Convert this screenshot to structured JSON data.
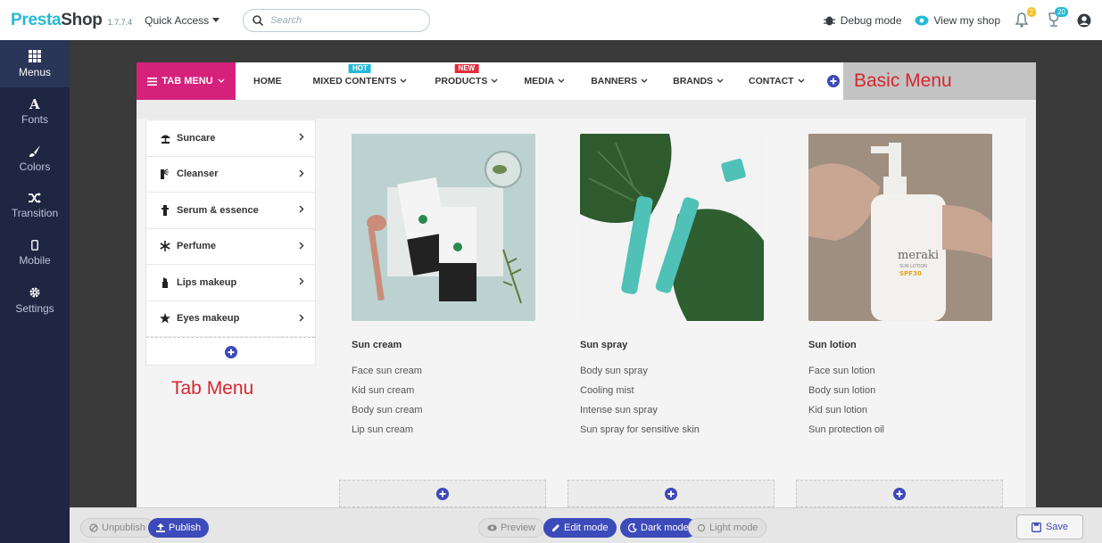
{
  "topbar": {
    "logo_part1": "Presta",
    "logo_part2": "Shop",
    "version": "1.7.7.4",
    "quick_access": "Quick Access",
    "search_placeholder": "Search",
    "debug_mode": "Debug mode",
    "view_shop": "View my shop",
    "notif_badge": "2",
    "notif2_badge": "20"
  },
  "sidebar": {
    "items": [
      {
        "label": "Menus",
        "icon": "grid-icon"
      },
      {
        "label": "Fonts",
        "icon": "font-icon"
      },
      {
        "label": "Colors",
        "icon": "brush-icon"
      },
      {
        "label": "Transition",
        "icon": "shuffle-icon"
      },
      {
        "label": "Mobile",
        "icon": "mobile-icon"
      },
      {
        "label": "Settings",
        "icon": "gear-icon"
      }
    ]
  },
  "menubar": {
    "tab_menu": "TAB MENU",
    "items": [
      {
        "label": "HOME",
        "tag": "",
        "dropdown": false
      },
      {
        "label": "MIXED CONTENTS",
        "tag": "HOT",
        "tag_color": "#25b9d7",
        "dropdown": true
      },
      {
        "label": "PRODUCTS",
        "tag": "NEW",
        "tag_color": "#e22d3d",
        "dropdown": true
      },
      {
        "label": "MEDIA",
        "tag": "",
        "dropdown": true
      },
      {
        "label": "BANNERS",
        "tag": "",
        "dropdown": true
      },
      {
        "label": "BRANDS",
        "tag": "",
        "dropdown": true
      },
      {
        "label": "CONTACT",
        "tag": "",
        "dropdown": true
      }
    ],
    "basic_label": "Basic Menu"
  },
  "tablist": {
    "items": [
      {
        "label": "Suncare",
        "icon": "sun-umbrella-icon"
      },
      {
        "label": "Cleanser",
        "icon": "spray-icon"
      },
      {
        "label": "Serum & essence",
        "icon": "dropper-bottle-icon"
      },
      {
        "label": "Perfume",
        "icon": "snowflake-icon"
      },
      {
        "label": "Lips makeup",
        "icon": "lipstick-icon"
      },
      {
        "label": "Eyes makeup",
        "icon": "star-icon"
      }
    ],
    "label": "Tab Menu"
  },
  "products": [
    {
      "name": "Sun cream",
      "links": [
        "Face sun cream",
        "Kid sun cream",
        "Body sun cream",
        "Lip sun cream"
      ]
    },
    {
      "name": "Sun spray",
      "links": [
        "Body sun spray",
        "Cooling mist",
        "Intense sun spray",
        "Sun spray for sensitive skin"
      ]
    },
    {
      "name": "Sun lotion",
      "links": [
        "Face sun lotion",
        "Body sun lotion",
        "Kid sun lotion",
        "Sun protection oil"
      ]
    }
  ],
  "product_image_text": {
    "bottle_brand": "meraki",
    "bottle_sub": "SUN LOTION",
    "bottle_spf": "SPF30"
  },
  "bottombar": {
    "unpublish": "Unpublish",
    "publish": "Publish",
    "preview": "Preview",
    "edit_mode": "Edit mode",
    "dark_mode": "Dark mode",
    "light_mode": "Light mode",
    "save": "Save"
  },
  "colors": {
    "accent_blue": "#3d4ab9",
    "tab_pink": "#d6217b",
    "label_red": "#d6272f",
    "sidebar_bg": "#1e2642"
  }
}
